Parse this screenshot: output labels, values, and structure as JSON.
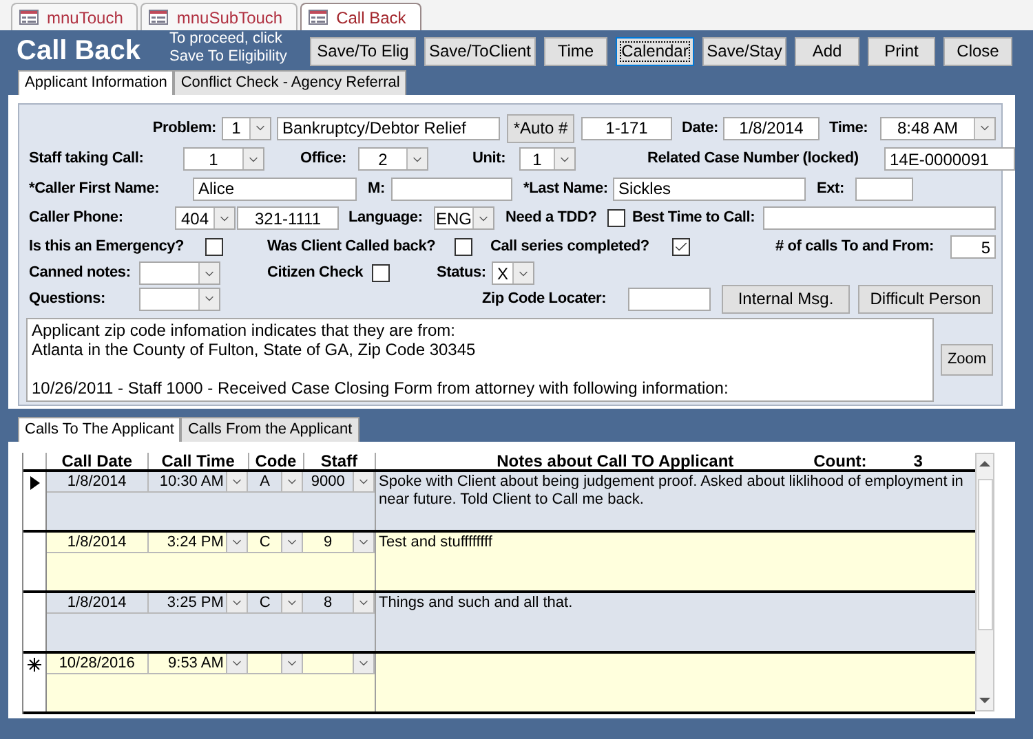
{
  "doc_tabs": [
    {
      "label": "mnuTouch",
      "selected": false
    },
    {
      "label": "mnuSubTouch",
      "selected": false
    },
    {
      "label": "Call Back",
      "selected": true
    }
  ],
  "form": {
    "title": "Call Back",
    "hint_lines": [
      "To proceed, click",
      "Save To Eligibility"
    ],
    "buttons": [
      {
        "label": "Save/To Elig",
        "focused": false
      },
      {
        "label": "Save/ToClient",
        "focused": false
      },
      {
        "label": "Time",
        "focused": false
      },
      {
        "label": "Calendar",
        "focused": true
      },
      {
        "label": "Save/Stay",
        "focused": false
      },
      {
        "label": "Add",
        "focused": false
      },
      {
        "label": "Print",
        "focused": false
      },
      {
        "label": "Close",
        "focused": false
      }
    ],
    "tabs": [
      {
        "label": "Applicant Information",
        "selected": true
      },
      {
        "label": "Conflict Check - Agency Referral",
        "selected": false
      }
    ],
    "lines": [
      {
        "items": [
          {
            "kind": "label",
            "text": "Problem:"
          },
          {
            "kind": "combo",
            "value": "1"
          },
          {
            "kind": "text",
            "value": "Bankruptcy/Debtor Relief"
          },
          {
            "kind": "button",
            "label": "*Auto #"
          },
          {
            "kind": "text",
            "value": "1-171"
          },
          {
            "kind": "label",
            "text": "Date:"
          },
          {
            "kind": "text",
            "value": "1/8/2014"
          },
          {
            "kind": "label",
            "text": "Time:"
          },
          {
            "kind": "combo",
            "value": "8:48 AM"
          }
        ]
      },
      {
        "items": [
          {
            "kind": "label",
            "text": "Staff taking Call:"
          },
          {
            "kind": "combo",
            "value": "1"
          },
          {
            "kind": "label",
            "text": "Office:"
          },
          {
            "kind": "combo",
            "value": "2"
          },
          {
            "kind": "label",
            "text": "Unit:"
          },
          {
            "kind": "combo",
            "value": "1"
          },
          {
            "kind": "label",
            "text": "Related Case Number (locked)"
          },
          {
            "kind": "text",
            "value": "14E-0000091"
          }
        ]
      },
      {
        "items": [
          {
            "kind": "label",
            "text": "*Caller First Name:"
          },
          {
            "kind": "text",
            "value": "Alice"
          },
          {
            "kind": "label",
            "text": "M:"
          },
          {
            "kind": "text"
          },
          {
            "kind": "label",
            "text": "*Last Name:"
          },
          {
            "kind": "text",
            "value": "Sickles"
          },
          {
            "kind": "label",
            "text": "Ext:"
          },
          {
            "kind": "text"
          }
        ]
      },
      {
        "items": [
          {
            "kind": "label",
            "text": "Caller Phone:"
          },
          {
            "kind": "combo",
            "value": "404"
          },
          {
            "kind": "text",
            "value": "321-1111"
          },
          {
            "kind": "label",
            "text": "Language:"
          },
          {
            "kind": "combo",
            "value": "ENG"
          },
          {
            "kind": "label",
            "text": "Need a TDD?"
          },
          {
            "kind": "checkbox",
            "checked": false
          },
          {
            "kind": "label",
            "text": "Best Time to Call:"
          },
          {
            "kind": "text"
          }
        ]
      },
      {
        "items": [
          {
            "kind": "label",
            "text": "Is this an Emergency?"
          },
          {
            "kind": "checkbox",
            "checked": false
          },
          {
            "kind": "label",
            "text": "Was Client Called back?"
          },
          {
            "kind": "checkbox",
            "checked": false
          },
          {
            "kind": "label",
            "text": "Call series completed?"
          },
          {
            "kind": "checkbox",
            "checked": true
          },
          {
            "kind": "label",
            "text": "# of calls To and From:"
          },
          {
            "kind": "text",
            "value": "5"
          }
        ]
      },
      {
        "items": [
          {
            "kind": "label",
            "text": "Canned notes:"
          },
          {
            "kind": "combo"
          },
          {
            "kind": "label",
            "text": "Citizen Check"
          },
          {
            "kind": "checkbox",
            "checked": false
          },
          {
            "kind": "label",
            "text": "Status:"
          },
          {
            "kind": "combo",
            "value": "X"
          }
        ]
      },
      {
        "items": [
          {
            "kind": "label",
            "text": "Questions:"
          },
          {
            "kind": "combo"
          },
          {
            "kind": "label",
            "text": "Zip Code Locater:"
          },
          {
            "kind": "text"
          },
          {
            "kind": "button",
            "label": "Internal Msg."
          },
          {
            "kind": "button",
            "label": "Difficult Person"
          }
        ]
      }
    ],
    "notes": [
      [
        "Applicant zip code infomation indicates that they are from:",
        "Atlanta in the County of Fulton, State of GA, Zip Code 30345"
      ],
      [
        "10/26/2011 - Staff 1000 - Received Case Closing Form from attorney with following information:"
      ]
    ],
    "zoom_button": "Zoom"
  },
  "call_tabs": [
    {
      "label": "Calls To The Applicant",
      "selected": true
    },
    {
      "label": "Calls From the Applicant",
      "selected": false
    }
  ],
  "calls_grid": {
    "columns": [
      "Call Date",
      "Call Time",
      "Code",
      "Staff",
      "Notes about Call TO Applicant"
    ],
    "count_label": "Count:",
    "count": "3",
    "rows": [
      {
        "kind": "record",
        "current": true,
        "call_date": "1/8/2014",
        "call_time": "10:30 AM",
        "code": "A",
        "staff": "9000",
        "notes": "Spoke with Client about being judgement proof. Asked about liklihood of employment in near future. Told Client to Call me back."
      },
      {
        "kind": "record",
        "current": false,
        "call_date": "1/8/2014",
        "call_time": "3:24 PM",
        "code": "C",
        "staff": "9",
        "notes": "Test and stuffffffff"
      },
      {
        "kind": "record",
        "current": false,
        "call_date": "1/8/2014",
        "call_time": "3:25 PM",
        "code": "C",
        "staff": "8",
        "notes": "Things and such and all that."
      },
      {
        "kind": "new",
        "current": false,
        "call_date": "10/28/2016",
        "call_time": "9:53 AM"
      }
    ]
  }
}
